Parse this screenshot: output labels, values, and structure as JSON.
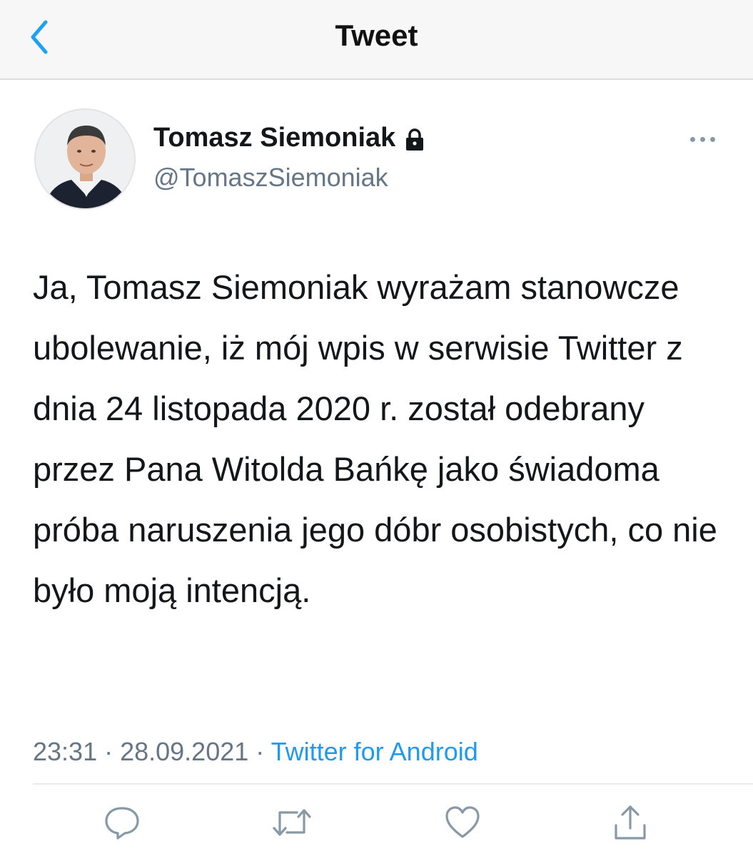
{
  "header": {
    "title": "Tweet",
    "back_icon": "chevron-left-icon",
    "accent_color": "#1da1f2"
  },
  "author": {
    "name": "Tomasz Siemoniak",
    "handle": "@TomaszSiemoniak",
    "protected_icon": "lock-icon"
  },
  "tweet": {
    "text": "Ja, Tomasz Siemoniak wyrażam stanowcze ubolewanie, iż mój wpis w serwisie Twitter z dnia 24 listopada 2020 r. został odebrany przez Pana Witolda Bańkę jako świadoma próba naruszenia jego dóbr osobistych, co nie było moją intencją.",
    "time": "23:31",
    "separator": " · ",
    "date": "28.09.2021",
    "source": "Twitter for Android"
  },
  "actions": [
    {
      "name": "reply",
      "icon": "reply-icon"
    },
    {
      "name": "retweet",
      "icon": "retweet-icon"
    },
    {
      "name": "like",
      "icon": "heart-icon"
    },
    {
      "name": "share",
      "icon": "share-icon"
    }
  ],
  "colors": {
    "text": "#14171a",
    "secondary": "#657786",
    "link": "#1d9bf0",
    "icon": "#8899a6"
  }
}
